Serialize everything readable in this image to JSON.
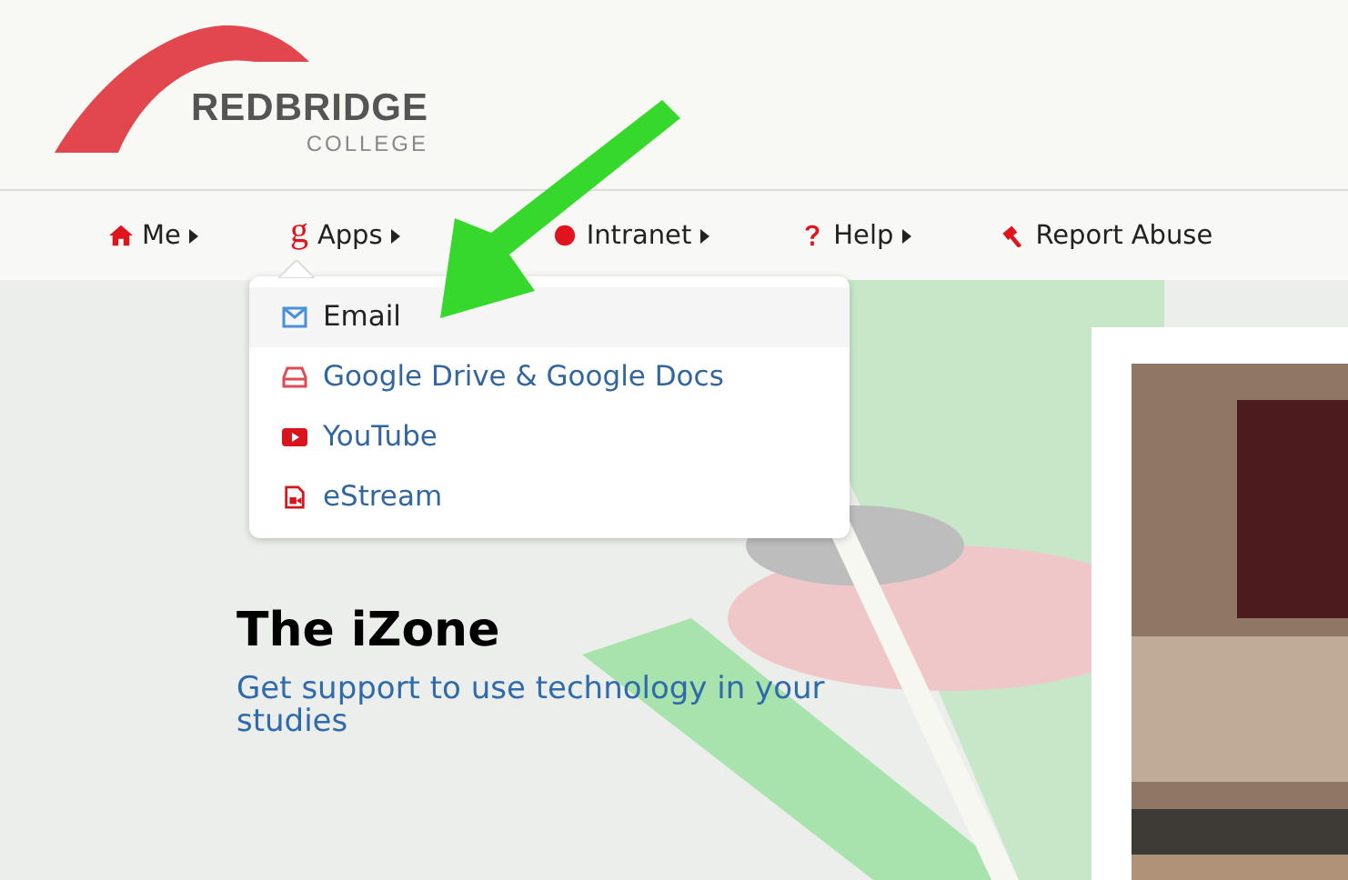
{
  "logo": {
    "name": "REDBRIDGE",
    "subtitle": "COLLEGE"
  },
  "nav": [
    {
      "label": "Me",
      "submenu": true,
      "expanded": false
    },
    {
      "glyph": "g",
      "label": "Apps",
      "submenu": true,
      "expanded": true
    },
    {
      "label": "Intranet",
      "submenu": true,
      "expanded": false
    },
    {
      "label": "Help",
      "submenu": true,
      "expanded": false
    },
    {
      "label": "Report Abuse",
      "submenu": false
    }
  ],
  "dropdown": [
    {
      "label": "Email",
      "selected": true
    },
    {
      "label": "Google Drive & Google Docs",
      "selected": false
    },
    {
      "label": "YouTube",
      "selected": false
    },
    {
      "label": "eStream",
      "selected": false
    }
  ],
  "hero": {
    "title": "The iZone",
    "subtitle": "Get support to use technology in your studies"
  }
}
